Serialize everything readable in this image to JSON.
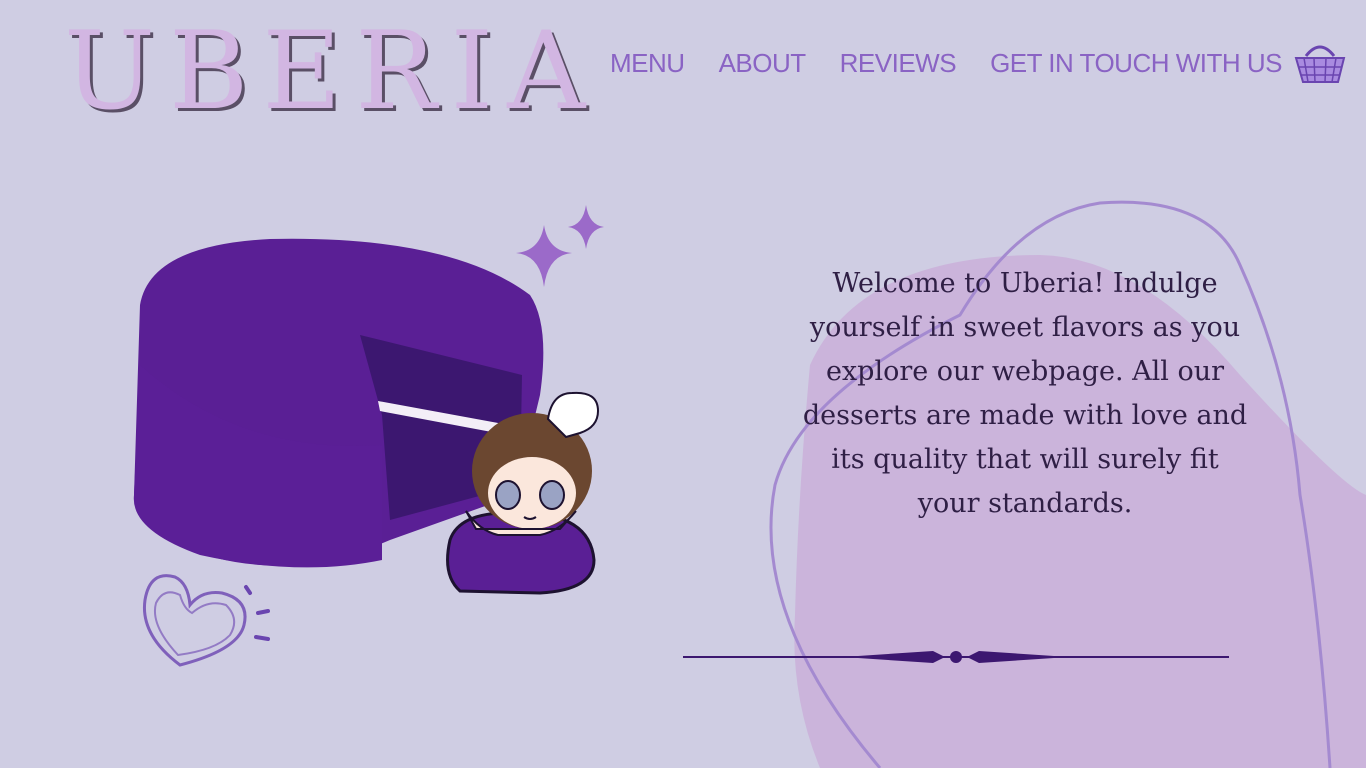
{
  "logo": {
    "text": "UBERIA"
  },
  "nav": {
    "items": [
      {
        "label": "MENU"
      },
      {
        "label": "ABOUT"
      },
      {
        "label": "REVIEWS"
      },
      {
        "label": "GET IN TOUCH WITH US"
      }
    ],
    "cart_icon": "basket-icon"
  },
  "hero": {
    "welcome_text": "Welcome to Uberia! Indulge yourself in sweet flavors as you explore our webpage. All our desserts are made with love and its quality that will surely fit your standards."
  },
  "colors": {
    "background": "#cfcde3",
    "accent": "#8a63c4",
    "cake": "#5a1f95",
    "blob": "#cbb4db",
    "text": "#2f1f45"
  }
}
